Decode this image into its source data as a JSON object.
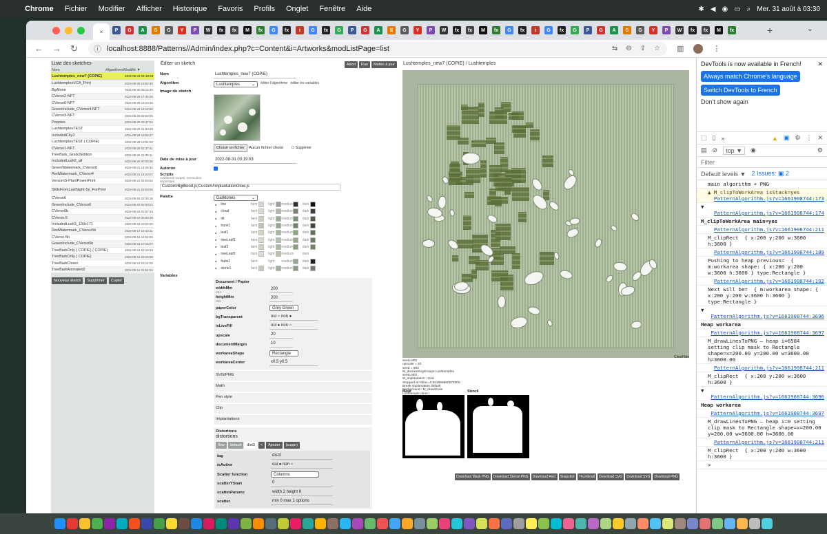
{
  "menubar": {
    "app": "Chrome",
    "items": [
      "Fichier",
      "Modifier",
      "Afficher",
      "Historique",
      "Favoris",
      "Profils",
      "Onglet",
      "Fenêtre",
      "Aide"
    ],
    "clock": "Mer. 31 août à 03:30"
  },
  "tabs": {
    "icons": [
      "P",
      "G",
      "A",
      "S",
      "G",
      "Y",
      "P",
      "W",
      "fx",
      "fx",
      "M",
      "fx",
      "G",
      "fx",
      "i",
      "G",
      "fx",
      "G"
    ],
    "active_close": "×",
    "new_tab": "+"
  },
  "browser": {
    "url": "localhost:8888/Patterns//Admin/index.php?c=Content&i=Artworks&modListPage=list"
  },
  "list": {
    "title": "Liste des sketches",
    "col_name": "Nom",
    "col_algo": "Algorithme",
    "col_mod": "Modifié ▼",
    "rows": [
      {
        "name": "Lushtemples_new7 (COPIE)",
        "date": "2022-08-31 03:19:03"
      },
      {
        "name": "LushtemplesVCA_Print",
        "date": "2022-08-30 13:52:40"
      },
      {
        "name": "BgAlone",
        "date": "2022-08-30 09:14:40"
      },
      {
        "name": "CVerso2-NFT",
        "date": "2022-08-29 17:44:26"
      },
      {
        "name": "CVerso6-NFT",
        "date": "2022-08-29 13:23:35"
      },
      {
        "name": "GreenInclude_CVerso4-NFT",
        "date": "2022-08-29 13:12:50"
      },
      {
        "name": "CVerso3-NFT",
        "date": "2022-08-29 02:52:05"
      },
      {
        "name": "Poppies",
        "date": "2022-08-29 22:47:04"
      },
      {
        "name": "LushtemplesTEST",
        "date": "2022-08-29 21:50:49"
      },
      {
        "name": "IncludedCity3",
        "date": "2022-08-28 18:56:47"
      },
      {
        "name": "LushtemplesTEST ( COPIE)",
        "date": "2022-08-28 13:01:02"
      },
      {
        "name": "CVerso1-NFT",
        "date": "2022-08-28 01:37:41"
      },
      {
        "name": "TreeBark_Gralx2Edition",
        "date": "2022-08-26 21:35:11"
      },
      {
        "name": "IncludedLush2_all",
        "date": "2022-08-26 00:05:35"
      },
      {
        "name": "GreenWatermark_CVerso6",
        "date": "2022-08-21 14:25:32"
      },
      {
        "name": "RedWatermark_CVerso4",
        "date": "2022-08-21 14:22:07"
      },
      {
        "name": "VersumS-PlantPowerPrint",
        "date": "2022-08-21 02:03:52"
      },
      {
        "name": "StillsFromLastNight-5e_ForPrint",
        "date": "2022-08-21 02:03:06"
      },
      {
        "name": "CVerso6",
        "date": "2022-08-19 22:30:18"
      },
      {
        "name": "GreenInclude_CVerso6",
        "date": "2022-08-19 02:00:22"
      },
      {
        "name": "CVerso6b",
        "date": "2022-08-19 01:57:34"
      },
      {
        "name": "CVerso-5",
        "date": "2022-08-19 20:00:19"
      },
      {
        "name": "IncludedLush3_130x171",
        "date": "2022-08-18 19:04:20"
      },
      {
        "name": "RedWatermark_CVerso5b",
        "date": "2022-08-17 16:43:11"
      },
      {
        "name": "CVerso-5b",
        "date": "2022-08-16 14:01:02"
      },
      {
        "name": "GreenInclude_CVerso5b",
        "date": "2022-08-15 17:15:07"
      },
      {
        "name": "TreeBarkOnly ( COPIE) ( COPIE)",
        "date": "2022-08-14 22:18:34"
      },
      {
        "name": "TreeBarkOnly ( COPIE)",
        "date": "2022-08-14 23:15:59"
      },
      {
        "name": "TreeBarkCloser",
        "date": "2022-08-14 23:14:29"
      },
      {
        "name": "TreeBarkAnimated2",
        "date": "2022-08-14 21:51:04"
      }
    ],
    "buttons": {
      "new": "Nouveau sketch",
      "delete": "Supprimer",
      "copy": "Copier"
    }
  },
  "edit": {
    "title": "Éditer un sketch",
    "top_buttons": [
      "Abort",
      "Run",
      "Mettre à jour"
    ],
    "name_label": "Nom",
    "name_value": "Lushtemples_new7 (COPIE)",
    "algo_label": "Algorithm",
    "algo_value": "Lushtemples",
    "algo_edit": "éditer l'algorithme",
    "vars_edit": "éditer les variables",
    "image_label": "Image du sketch",
    "file_button": "Choisir un fichier",
    "file_none": "Aucun fichier choisi",
    "delete_check": "Supprimer",
    "date_label": "Date de mise à jour",
    "date_value": "2022-08-31 03:19:03",
    "autorun_label": "Autorun",
    "scripts_label": "Scripts",
    "scripts_sub": "Additional scripts, semicolon separated",
    "scripts_value": "Custom/BgBlood.js;Custom/ImplantationGlow.js",
    "palette_label": "Palette",
    "palette_value": "Darktones",
    "palette_rows": [
      {
        "name": "line",
        "faint": "#cfd6cb",
        "light": "#9aa598",
        "medium": "#2a2e2a",
        "dark": "#111111"
      },
      {
        "name": "cloud",
        "faint": "#d9ddd4",
        "light": "#b1b7ad",
        "medium": "#7a7f76",
        "dark": "#3a3d39"
      },
      {
        "name": "tilt",
        "faint": "#c6d2bd",
        "light": "#9eb094",
        "medium": "#7d9175",
        "dark": "#4c5a46"
      },
      {
        "name": "trunk1",
        "faint": "#b8c7ae",
        "light": "#95a88a",
        "medium": "#6f8366",
        "dark": "#3d4a38"
      },
      {
        "name": "leaf1",
        "faint": "#cdd8c2",
        "light": "#a6b99a",
        "medium": "#8ea480",
        "dark": "#5f7356"
      },
      {
        "name": "treeLeaf1",
        "faint": "#d4ddca",
        "light": "#b2c2a6",
        "medium": "#94a98a",
        "dark": "#6a7d60"
      },
      {
        "name": "leaf2",
        "faint": "#c9d5bf",
        "light": "#a9bb9d",
        "medium": "#8aa07e",
        "dark": "#6c8162"
      },
      {
        "name": "treeLeaf2",
        "faint": "#d8dfd1",
        "light": "#b7c3ae",
        "medium": "",
        "dark": ""
      },
      {
        "name": "fruits1",
        "faint": "",
        "light": "",
        "medium": "#9aa596",
        "dark": "#222222"
      },
      {
        "name": "stone1",
        "faint": "#c3cdbb",
        "light": "#a3b199",
        "medium": "#8d9b84",
        "dark": "#707c69"
      }
    ],
    "palette_labels": {
      "faint": "faint",
      "light": "light",
      "medium": "medium",
      "dark": "dark"
    },
    "vars_label": "Variables",
    "doc_title": "Document / Papier",
    "doc": [
      {
        "k": "widthMm",
        "sub": "mm",
        "v": "200"
      },
      {
        "k": "heightMm",
        "sub": "mm",
        "v": "200"
      },
      {
        "k": "paperColor",
        "sub": "",
        "v": "Grey Green"
      },
      {
        "k": "bgTransparent",
        "sub": "",
        "v": "oui ○   non ●"
      },
      {
        "k": "isLiveFill",
        "sub": "",
        "v": "oui ●   non ○"
      },
      {
        "k": "upscale",
        "sub": "",
        "v": "20"
      },
      {
        "k": "documentMargin",
        "sub": "",
        "v": "10"
      },
      {
        "k": "workareaShape",
        "sub": "",
        "v": "Rectangle"
      },
      {
        "k": "workareaCenter",
        "sub": "",
        "v": "x0.5      y0.5"
      }
    ],
    "sections": [
      "SVG/PNG",
      "Math",
      "Pen style",
      "Clip",
      "Implantations"
    ],
    "distortions_title": "Distortions",
    "distortions_sub": "distortions",
    "dist_tabs": [
      "flow",
      "default",
      "dist3",
      "<",
      "Ajouter",
      "(suppr)"
    ],
    "dist": [
      {
        "k": "tag",
        "v": "dist3"
      },
      {
        "k": "isActive",
        "v": "oui ●   non ○"
      },
      {
        "k": "Scatter function",
        "v": "Columns"
      },
      {
        "k": "scatterYStart",
        "v": "0"
      },
      {
        "k": "scatterParams",
        "v": "width 2   height 8"
      },
      {
        "k": "scatter",
        "v": "min 0   max 1   options"
      }
    ]
  },
  "preview": {
    "title": "Lushtemples_new7 (COPIE) / Lushtemples",
    "clearhide": "ClearHide",
    "log": [
      "seed=802",
      "upscale = 20",
      "seed = 802",
      "M_declareSvgGroups Lushtemples",
      "seed=802",
      "M_implantation : Grid",
      "Stopped at %frac=0.521665880076305",
      "Break implantation default",
      "Background : M_drawGrain",
      "Lushtemple done !"
    ],
    "mask_label": "Mask",
    "stencil_label": "Stencil",
    "downloads": [
      "Download Mask PNG",
      "Download Stencil PNG",
      "Download Rect",
      "Snapshot",
      "Thumbnail",
      "Download SVG",
      "Download SVG",
      "Download PNG"
    ]
  },
  "devtools": {
    "note": "DevTools is now available in French!",
    "btn1": "Always match Chrome's language",
    "btn2": "Switch DevTools to French",
    "btn3": "Don't show again",
    "top": "top ▼",
    "filter": "Filter",
    "levels": "Default levels ▼",
    "issues": "2 Issues: ▣ 2",
    "lines": [
      {
        "cls": "",
        "t": "main algorithm + PNG"
      },
      {
        "cls": "warn",
        "t": "▲ M_clipToWorkArea isStack=yes",
        "link": "PatternAlgorithm.js?v=1661908744:173"
      },
      {
        "cls": "grp",
        "t": "▼",
        "link": "PatternAlgorithm.js?v=1661908744:174"
      },
      {
        "cls": "grp",
        "bold": "M_clipToWorkArea main=yes"
      },
      {
        "cls": "",
        "link": "PatternAlgorithm.js?v=1661908744:211"
      },
      {
        "cls": "",
        "t": "M_clipRect  { x:200 y:200 w:3600 h:3600 }"
      },
      {
        "cls": "",
        "link": "PatternAlgorithm.js?v=1661908744:189"
      },
      {
        "cls": "",
        "t": "Pushing to heap previous=  { m:workarea shape: { x:200 y:200 w:3600 h:3600 } type:Rectangle }"
      },
      {
        "cls": "",
        "link": "PatternAlgorithm.js?v=1661908744:192"
      },
      {
        "cls": "",
        "t": "Next will be=  { m:workarea shape: { x:200 y:200 w:3600 h:3600 }  type:Rectangle }"
      },
      {
        "cls": "grp",
        "t": "▼",
        "link": "PatternAlgorithm.js?v=1661908744:3696"
      },
      {
        "cls": "grp",
        "bold": "Heap workarea"
      },
      {
        "cls": "",
        "link": "PatternAlgorithm.js?v=1661908744:3697"
      },
      {
        "cls": "",
        "t": "M_drawLinesToPNG – heap i=6584 setting clip mask to Rectangle shape=x=200.00 y=200.00 w=3600.00 h=3600.00"
      },
      {
        "cls": "",
        "link": "PatternAlgorithm.js?v=1661908744:211"
      },
      {
        "cls": "",
        "t": "M_clipRect  { x:200 y:200 w:3600 h:3600 }"
      },
      {
        "cls": "grp",
        "t": "▼",
        "link": "PatternAlgorithm.js?v=1661908744:3696"
      },
      {
        "cls": "grp",
        "bold": "Heap workarea"
      },
      {
        "cls": "",
        "link": "PatternAlgorithm.js?v=1661908744:3697"
      },
      {
        "cls": "",
        "t": "M_drawLinesToPNG – heap i=0 setting clip mask to Rectangle shape=x=200.00 y=200.00 w=3600.00 h=3600.00"
      },
      {
        "cls": "",
        "link": "PatternAlgorithm.js?v=1661908744:211"
      },
      {
        "cls": "",
        "t": "M_clipRect  { x:200 y:200 w:3600 h:3600 }"
      },
      {
        "cls": "",
        "t": ">"
      }
    ]
  }
}
